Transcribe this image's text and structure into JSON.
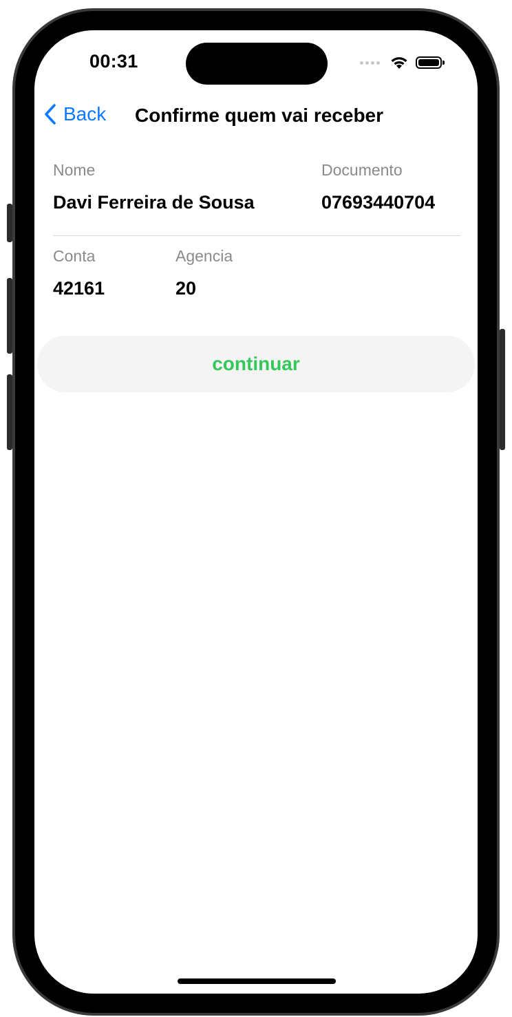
{
  "status_bar": {
    "time": "00:31",
    "wifi_icon": "wifi-icon",
    "battery_icon": "battery-icon"
  },
  "navbar": {
    "back_label": "Back",
    "title": "Confirme quem vai receber"
  },
  "recipient": {
    "name_label": "Nome",
    "name_value": "Davi Ferreira de Sousa",
    "document_label": "Documento",
    "document_value": "07693440704",
    "account_label": "Conta",
    "account_value": "42161",
    "agency_label": "Agencia",
    "agency_value": "20"
  },
  "actions": {
    "continue_label": "continuar"
  },
  "colors": {
    "accent": "#0a7aff",
    "success": "#34c759",
    "secondary_text": "#8a8a8e"
  }
}
